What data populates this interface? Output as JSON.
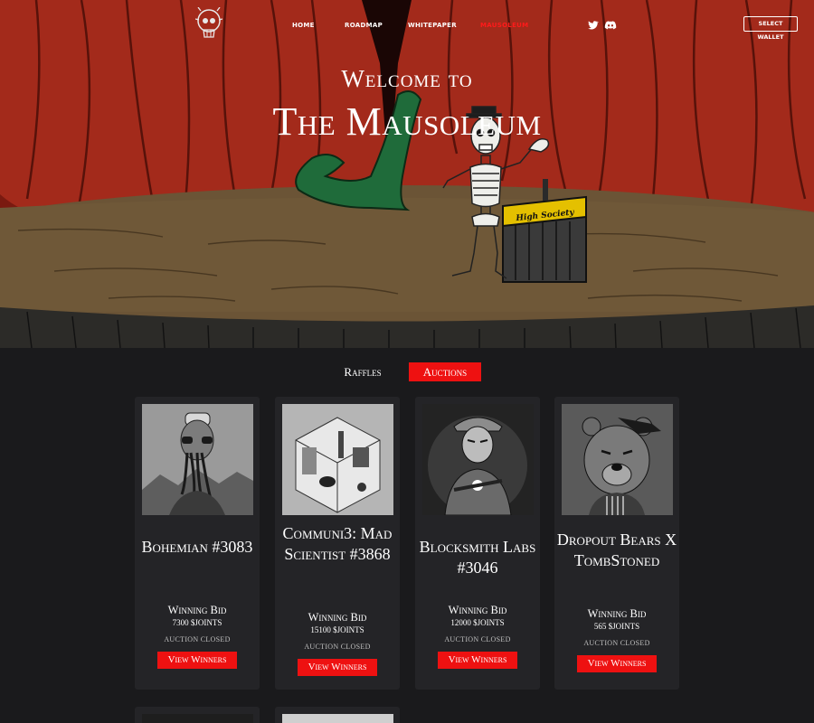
{
  "nav": {
    "links": [
      {
        "label": "HOME"
      },
      {
        "label": "ROADMAP"
      },
      {
        "label": "WHITEPAPER"
      },
      {
        "label": "MAUSOLEUM"
      }
    ],
    "active_index": 3,
    "wallet_label": "SELECT WALLET",
    "social_icons": [
      "twitter-icon",
      "discord-icon"
    ]
  },
  "hero": {
    "welcome": "Welcome to",
    "title": "The Mausoleum",
    "podium_sign": "High Society"
  },
  "tabs": {
    "items": [
      {
        "label": "Raffles"
      },
      {
        "label": "Auctions"
      }
    ],
    "active_index": 1
  },
  "cards": [
    {
      "name": "Bohemian #3083",
      "bid_label": "Winning Bid",
      "bid_value": "7300 $JOINTS",
      "status": "AUCTION CLOSED",
      "button": "View Winners"
    },
    {
      "name": "Communi3: Mad Scientist #3868",
      "bid_label": "Winning Bid",
      "bid_value": "15100 $JOINTS",
      "status": "AUCTION CLOSED",
      "button": "View Winners"
    },
    {
      "name": "Blocksmith Labs #3046",
      "bid_label": "Winning Bid",
      "bid_value": "12000 $JOINTS",
      "status": "AUCTION CLOSED",
      "button": "View Winners"
    },
    {
      "name": "Dropout Bears X TombStoned",
      "bid_label": "Winning Bid",
      "bid_value": "565 $JOINTS",
      "status": "AUCTION CLOSED",
      "button": "View Winners"
    }
  ],
  "colors": {
    "accent_red": "#ee1111",
    "page_bg": "#1a1a1c",
    "card_bg": "#242427"
  }
}
